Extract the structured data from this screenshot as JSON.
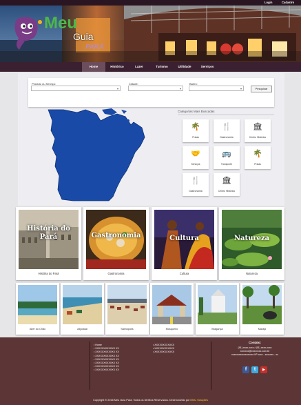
{
  "topbar": {
    "login": "Login",
    "signup": "Cadastro"
  },
  "logo": {
    "text_main": "Meu",
    "text_guia": "Guia",
    "text_region": "PARÁ"
  },
  "nav": [
    {
      "label": "Home",
      "active": true
    },
    {
      "label": "Histórico"
    },
    {
      "label": "Lazer"
    },
    {
      "label": "Turismo"
    },
    {
      "label": "Utilidade"
    },
    {
      "label": "Serviços"
    }
  ],
  "search": {
    "label_product": "Produto ou Serviço:",
    "label_city": "Cidade:",
    "label_neighborhood": "Bairro:",
    "button": "Pesquisar"
  },
  "categories": {
    "title": "Categorias Mais Buscadas",
    "items": [
      {
        "label": "Praias",
        "icon": "palm-tree-icon",
        "glyph": "🌴"
      },
      {
        "label": "Gastronomia",
        "icon": "restaurant-icon",
        "glyph": "🍴"
      },
      {
        "label": "Centro Histórico",
        "icon": "museum-icon",
        "glyph": "🏛"
      },
      {
        "label": "Serviços",
        "icon": "handshake-icon",
        "glyph": "🤝"
      },
      {
        "label": "Transporte",
        "icon": "bus-icon",
        "glyph": "🚌"
      },
      {
        "label": "Praias",
        "icon": "palm-tree-icon",
        "glyph": "🌴"
      },
      {
        "label": "Gastronomia",
        "icon": "restaurant-icon",
        "glyph": "🍴"
      },
      {
        "label": "Centro Histórico",
        "icon": "museum-icon",
        "glyph": "🏛"
      }
    ]
  },
  "featured": [
    {
      "overlay": "História do Pará",
      "caption": "História do Pará"
    },
    {
      "overlay": "Gastronomia",
      "caption": "Gastronomia"
    },
    {
      "overlay": "Cultura",
      "caption": "Cultura"
    },
    {
      "overlay": "Natureza",
      "caption": "Natureza"
    }
  ],
  "places": [
    {
      "caption": "Alter do Chão"
    },
    {
      "caption": "Algodoal"
    },
    {
      "caption": "Salinópolis"
    },
    {
      "caption": "Mosqueiro"
    },
    {
      "caption": "Bragança"
    },
    {
      "caption": "Marajó"
    }
  ],
  "footer": {
    "col1": [
      "Home",
      "XXXXXXXXXXXX XX",
      "XXXXXXXXXXXX XX",
      "XXXXXXXXXXXX XX",
      "XXXXXXXXXXXX XX",
      "XXXXXXXXXXXX XX",
      "XXXXXXXXXXXX XX",
      "XXXXXXXXXXXX XX"
    ],
    "col2": [
      "XXXXXXXXXXXX",
      "XXXXXXXXXXXX",
      "XXXXXXXXXXXX"
    ],
    "contacts_title": "Contato:",
    "phone": "(91) xxxx-xxxx / (91) xxxx-xxxx",
    "email": "xxxxxxx@xxxxxxxx.com.br",
    "address": "xxxxxxxxxxxxxxxxxx Nº xxxx - xxxxxxx - xx",
    "social": [
      {
        "name": "facebook-icon",
        "glyph": "f",
        "color": "#3b5998"
      },
      {
        "name": "twitter-icon",
        "glyph": "t",
        "color": "#3fa9e0"
      },
      {
        "name": "youtube-icon",
        "glyph": "▶",
        "color": "#c4302b"
      }
    ],
    "copyright": "Copyright © 2016 Meu Guia Pará. Todos os Direitos Reservados. Desenvolvido por",
    "developer": "MGU Soluções"
  }
}
